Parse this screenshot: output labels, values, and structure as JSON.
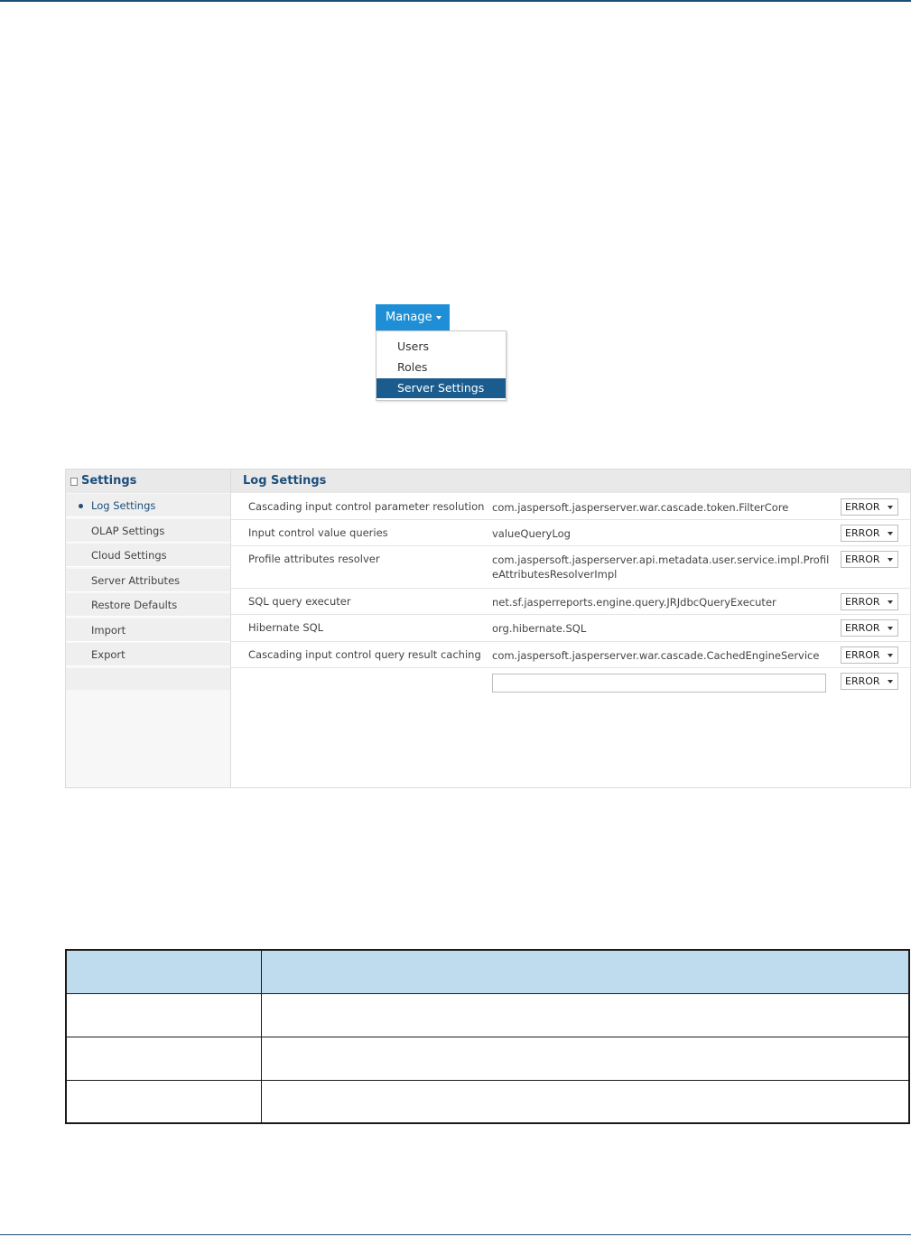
{
  "manage_menu": {
    "button_label": "Manage",
    "items": [
      "Users",
      "Roles",
      "Server Settings"
    ],
    "selected": "Server Settings",
    "accent_color": "#1e8fd6",
    "selected_color": "#1b5c8f"
  },
  "settings": {
    "sidebar_title": "Settings",
    "items": [
      "Log Settings",
      "OLAP Settings",
      "Cloud Settings",
      "Server Attributes",
      "Restore Defaults",
      "Import",
      "Export"
    ],
    "active_item": "Log Settings"
  },
  "log_settings": {
    "title": "Log Settings",
    "rows": [
      {
        "label": "Cascading input control parameter resolution",
        "logger": "com.jaspersoft.jasperserver.war.cascade.token.FilterCore",
        "level": "ERROR"
      },
      {
        "label": "Input control value queries",
        "logger": "valueQueryLog",
        "level": "ERROR"
      },
      {
        "label": "Profile attributes resolver",
        "logger": "com.jaspersoft.jasperserver.api.metadata.user.service.impl.ProfileAttributesResolverImpl",
        "level": "ERROR"
      },
      {
        "label": "SQL query executer",
        "logger": "net.sf.jasperreports.engine.query.JRJdbcQueryExecuter",
        "level": "ERROR"
      },
      {
        "label": "Hibernate SQL",
        "logger": "org.hibernate.SQL",
        "level": "ERROR"
      },
      {
        "label": "Cascading input control query result caching",
        "logger": "com.jaspersoft.jasperserver.war.cascade.CachedEngineService",
        "level": "ERROR"
      }
    ],
    "new_logger": {
      "value": "",
      "level": "ERROR"
    }
  },
  "table": {
    "header_color": "#bfdcef",
    "rows": 3
  }
}
